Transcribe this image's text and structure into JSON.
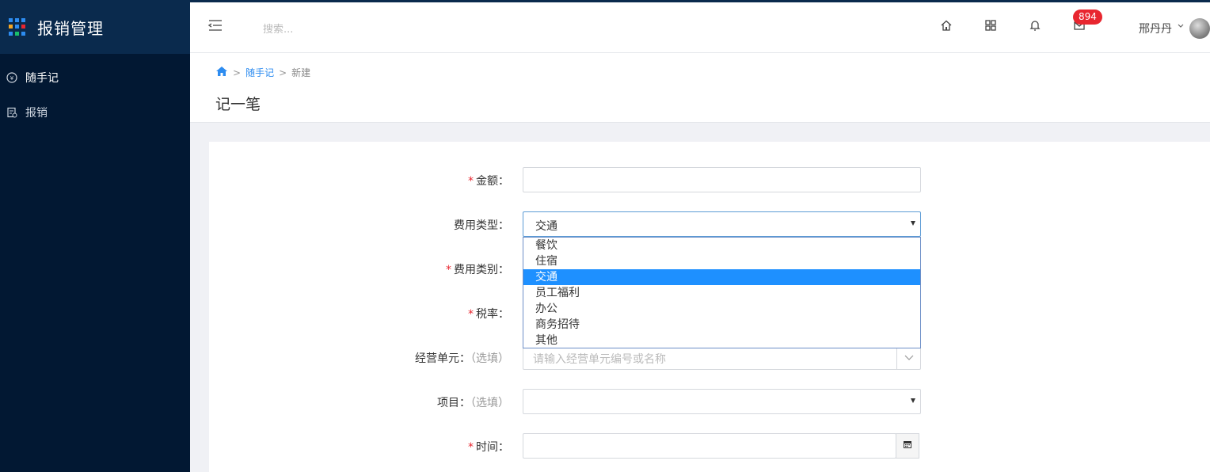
{
  "app": {
    "title": "报销管理"
  },
  "sidebar": {
    "items": [
      {
        "label": "随手记",
        "icon": "note-icon",
        "active": true
      },
      {
        "label": "报销",
        "icon": "receipt-icon",
        "active": false
      }
    ]
  },
  "topbar": {
    "search_placeholder": "搜索...",
    "icons": [
      "home-icon",
      "apps-icon",
      "bell-icon",
      "mail-icon"
    ],
    "mail_badge": "894",
    "user_name": "邢丹丹"
  },
  "breadcrumb": {
    "items": [
      "随手记",
      "新建"
    ],
    "separator": ">"
  },
  "page_title": "记一笔",
  "form": {
    "amount": {
      "label": "金额：",
      "required": true,
      "value": ""
    },
    "expense_type": {
      "label": "费用类型：",
      "value": "交通",
      "options": [
        "餐饮",
        "住宿",
        "交通",
        "员工福利",
        "办公",
        "商务招待",
        "其他"
      ],
      "selected_index": 2
    },
    "expense_category": {
      "label": "费用类别：",
      "required": true
    },
    "tax_rate": {
      "label": "税率：",
      "required": true
    },
    "business_unit": {
      "label": "经营单元：",
      "optional": "（选填）",
      "placeholder": "请输入经营单元编号或名称"
    },
    "project": {
      "label": "项目：",
      "optional": "（选填）",
      "value": ""
    },
    "time": {
      "label": "时间：",
      "required": true,
      "value": ""
    }
  },
  "colors": {
    "sidebar_bg": "#021833",
    "brand_bg": "#0a2a4d",
    "accent": "#2d8cf0",
    "selected_option": "#1e90ff",
    "badge": "#e8262f",
    "required": "#e8262f"
  }
}
